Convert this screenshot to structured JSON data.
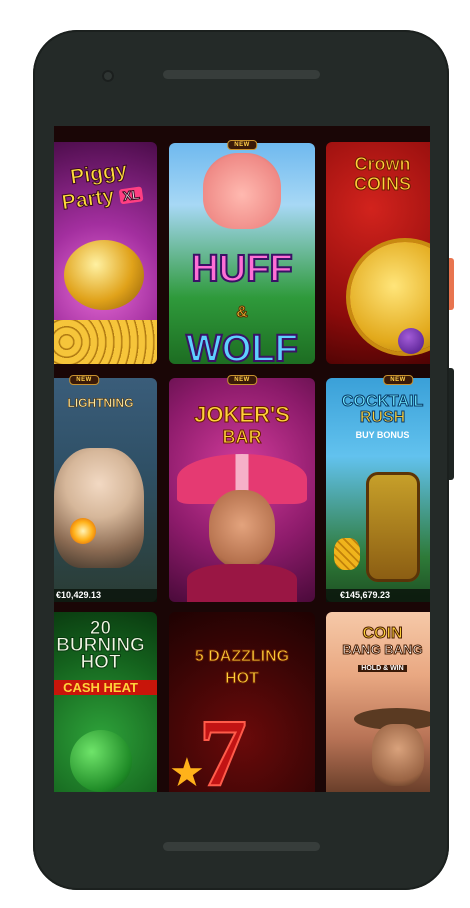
{
  "games": [
    {
      "title_line1": "Piggy",
      "title_line2": "Party",
      "title_suffix": "XL"
    },
    {
      "badge": "NEW",
      "title_line1": "HUFF",
      "title_amp": "&",
      "title_line2": "WOLF"
    },
    {
      "title_line1": "Crown",
      "title_line2": "COINS"
    },
    {
      "badge": "NEW",
      "title_line1": "LIGHTNING",
      "jackpot": "€10,429.13"
    },
    {
      "badge": "NEW",
      "title_line1": "JOKER'S",
      "title_line2": "BAR"
    },
    {
      "badge": "NEW",
      "title_line1": "COCKTAIL",
      "title_line2": "RUSH",
      "title_line3": "BUY BONUS",
      "jackpot": "€145,679.23"
    },
    {
      "title_line1": "20",
      "title_line2": "BURNING",
      "title_line3": "HOT",
      "title_line4": "CASH HEAT"
    },
    {
      "title_line1": "5 DAZZLING",
      "title_line2": "HOT"
    },
    {
      "title_line1": "COIN",
      "title_line2": "BANG BANG",
      "title_line3": "HOLD & WIN"
    }
  ]
}
